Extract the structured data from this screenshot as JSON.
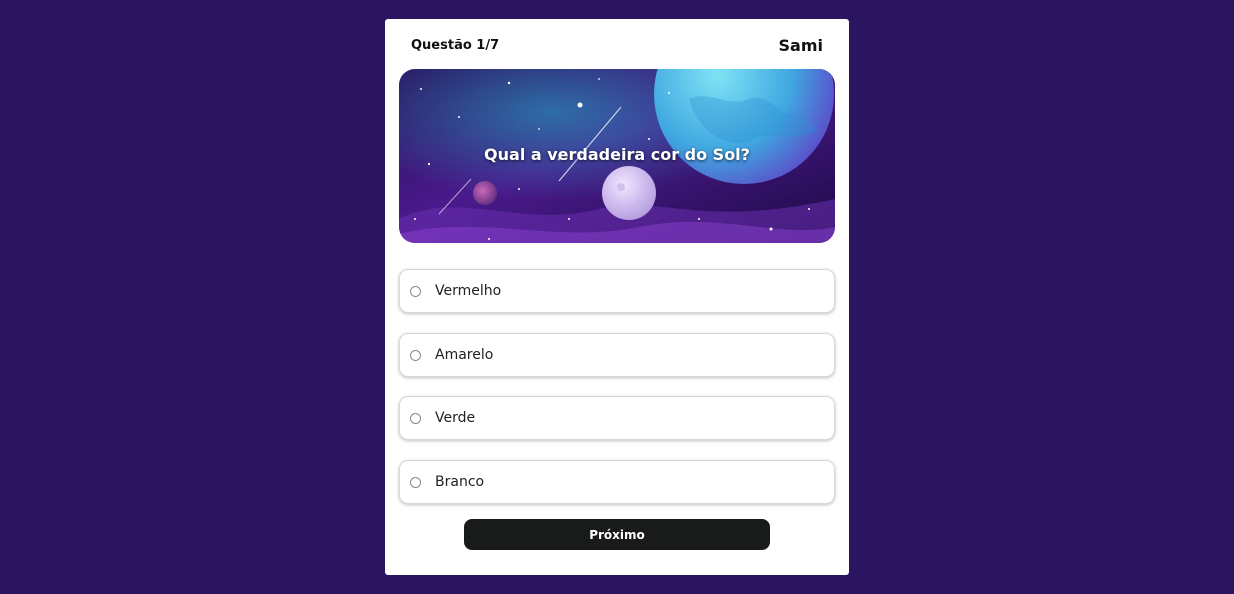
{
  "header": {
    "question_counter": "Questão 1/7",
    "username": "Sami"
  },
  "question": {
    "text": "Qual a verdadeira cor do Sol?",
    "banner_image": "space-planets-illustration"
  },
  "options": [
    {
      "label": "Vermelho",
      "selected": false
    },
    {
      "label": "Amarelo",
      "selected": false
    },
    {
      "label": "Verde",
      "selected": false
    },
    {
      "label": "Branco",
      "selected": false
    }
  ],
  "actions": {
    "next_label": "Próximo"
  },
  "colors": {
    "page_background": "#2b1460",
    "card_background": "#ffffff",
    "button_background": "#181b1a"
  }
}
